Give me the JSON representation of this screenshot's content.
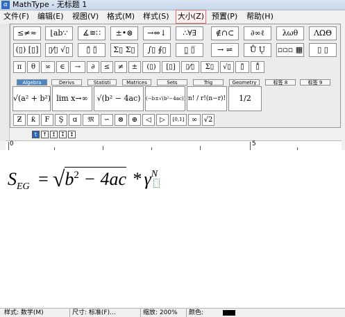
{
  "window": {
    "title": "MathType - 无标题 1"
  },
  "menu": [
    {
      "label": "文件(F)"
    },
    {
      "label": "编辑(E)"
    },
    {
      "label": "视图(V)"
    },
    {
      "label": "格式(M)"
    },
    {
      "label": "样式(S)"
    },
    {
      "label": "大小(Z)"
    },
    {
      "label": "预置(P)"
    },
    {
      "label": "帮助(H)"
    }
  ],
  "symbol_row1": [
    "≤≠≈",
    "⌊ab∵",
    "∡≋∷",
    "±•⊗",
    "→⇔↓",
    "∴∀∃",
    "∉∩⊂",
    "∂∞ℓ",
    "λωθ",
    "ΛΩΘ"
  ],
  "symbol_row2": [
    "(▯) [▯]",
    "▯⁄▯ √▯",
    "▯̄ ▯̆",
    "Σ▯ Σ▯",
    "∫▯ ∮▯",
    "▯̲ ▯̅",
    "→ ⇌",
    "Ů Ų",
    "▫▫▫ ▦",
    "▯ ▯"
  ],
  "symbol_row3": [
    "π",
    "θ",
    "∞",
    "∈",
    "→",
    "∂",
    "≤",
    "≠",
    "±",
    "(▯)",
    "[▯]",
    "▯⁄▯",
    "Σ▯",
    "√▯",
    "▯̄",
    "▯̊"
  ],
  "tabs": [
    {
      "label": "Algebra"
    },
    {
      "label": "Derivs"
    },
    {
      "label": "Statisti"
    },
    {
      "label": "Matrices"
    },
    {
      "label": "Sets"
    },
    {
      "label": "Trig"
    },
    {
      "label": "Geometry"
    },
    {
      "label": "标签 8"
    },
    {
      "label": "标签 9"
    }
  ],
  "templates": [
    "√(a² + b²)",
    "lim x→∞",
    "√(b² − 4ac)",
    "(−b±√(b²−4ac))/2a",
    "n! / r!(n−r)!",
    "1/2"
  ],
  "small_row": [
    "Ƶ",
    "ƙ",
    "Ϝ",
    "Ş",
    "ɑ",
    "𝔐",
    "∽",
    "⊗",
    "⊕",
    "◁",
    "▷",
    "[0,1]",
    "∞",
    "√2"
  ],
  "edit_toolbar": [
    "t",
    "↑",
    "↥",
    "↧",
    "↕"
  ],
  "ruler": {
    "start": "0",
    "mid": "5"
  },
  "formula": {
    "lhs_base": "S",
    "lhs_sub": "EG",
    "equals": "=",
    "rad_b": "b",
    "rad_b_exp": "2",
    "rad_rest": " − 4ac",
    "times": "*",
    "gamma": "γ",
    "gamma_sup": "N"
  },
  "status": {
    "style": "样式: 数学(M)",
    "size": "尺寸: 标准(F)...",
    "zoom": "缩放: 200%",
    "color_label": "颜色:",
    "color_value": "#000000"
  }
}
